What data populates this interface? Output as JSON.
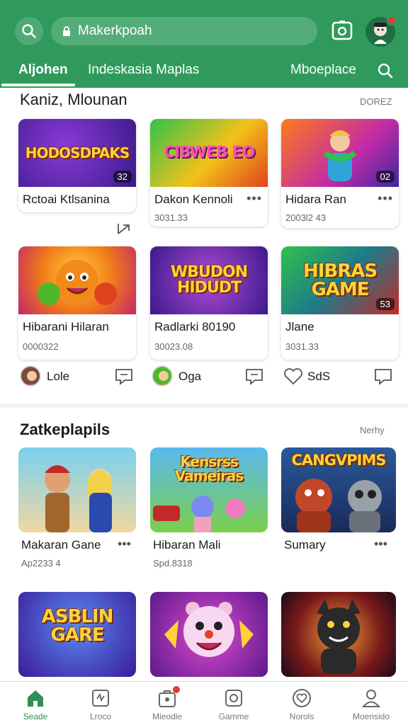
{
  "search": {
    "value": "Makerkpoah"
  },
  "tabs": [
    {
      "label": "Aljohen",
      "active": true
    },
    {
      "label": "Indeskasia Maplas",
      "active": false
    },
    {
      "label": "Mboeplace",
      "active": false
    }
  ],
  "section1": {
    "title": "Kaniz,  Mlounan",
    "link": "DOREZ",
    "cards": [
      {
        "thumb": "HODOSDPAKS",
        "badge": "32",
        "title": "Rctoai Ktlsanina",
        "sub": ""
      },
      {
        "thumb": "CIBWEB EO",
        "badge": "",
        "title": "Dakon Kennoli",
        "sub": "3031.33"
      },
      {
        "thumb": "",
        "badge": "02",
        "title": "Hidara Ran",
        "sub": "2003l2 43"
      },
      {
        "thumb": "",
        "badge": "",
        "title": "Hibarani Hilaran",
        "sub": "0000322"
      },
      {
        "thumb": "WBUDON HIDUDT",
        "badge": "",
        "title": "Radlarki 80190",
        "sub": "30023.08"
      },
      {
        "thumb": "HIBRAS GAME",
        "badge": "53",
        "title": "Jlane",
        "sub": "3031.33"
      }
    ],
    "social": [
      {
        "name": "Lole"
      },
      {
        "name": "Oga"
      },
      {
        "name": "SdS"
      }
    ]
  },
  "section2": {
    "title": "Zatkeplapils",
    "link": "Nerhy",
    "cards": [
      {
        "thumb": "",
        "title": "Makaran Gane",
        "sub": "Ap2233 4"
      },
      {
        "thumb": "Kensrss Vameiras",
        "title": "Hibaran Mali",
        "sub": "Spd.8318"
      },
      {
        "thumb": "CANGVPIMS",
        "title": "Sumary",
        "sub": ""
      },
      {
        "thumb": "ASBLIN GARE",
        "title": "",
        "sub": ""
      },
      {
        "thumb": "",
        "title": "",
        "sub": ""
      },
      {
        "thumb": "",
        "title": "",
        "sub": ""
      }
    ]
  },
  "nav": [
    {
      "label": "Seade",
      "icon": "home-icon",
      "active": true
    },
    {
      "label": "Lroco",
      "icon": "games-icon",
      "active": false
    },
    {
      "label": "Mieodle",
      "icon": "store-icon",
      "active": false
    },
    {
      "label": "Gamme",
      "icon": "gamepad-icon",
      "active": false
    },
    {
      "label": "Norols",
      "icon": "heart-icon",
      "active": false
    },
    {
      "label": "Moensido",
      "icon": "profile-icon",
      "active": false
    }
  ],
  "colors": {
    "brand": "#2f9a5c",
    "active_nav": "#2f8f55",
    "notification": "#e53935"
  }
}
